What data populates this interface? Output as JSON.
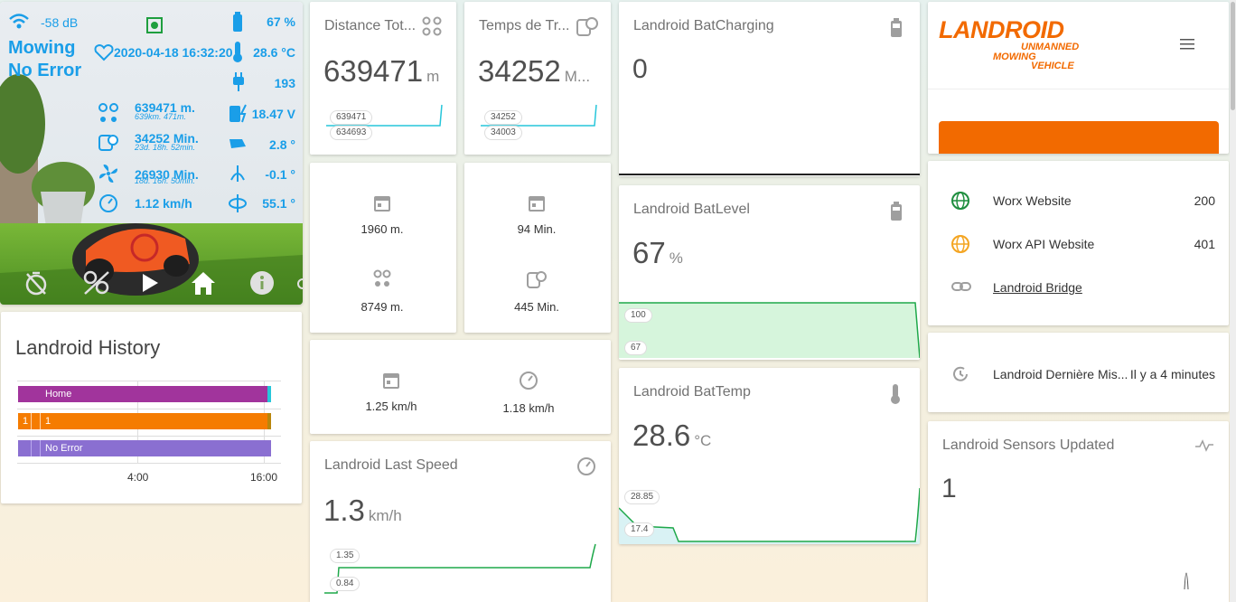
{
  "mower": {
    "wifi": "-58 dB",
    "status": "Mowing",
    "error": "No Error",
    "datetime": "2020-04-18 16:32:20",
    "battery": "67 %",
    "temperature": "28.6 °C",
    "charge_cycles": "193",
    "distance": "639471 m.",
    "distance_sub": "639km. 471m.",
    "voltage": "18.47 V",
    "work_time": "34252 Min.",
    "work_time_sub": "23d. 18h. 52min.",
    "pitch": "2.8 °",
    "blade_time": "26930 Min.",
    "blade_time_sub": "18d. 16h. 50min.",
    "roll": "-0.1 °",
    "speed": "1.12 km/h",
    "yaw": "55.1 °"
  },
  "distance_card": {
    "title": "Distance Tot...",
    "value": "639471",
    "unit": "m",
    "max": "639471",
    "min": "634693"
  },
  "time_card": {
    "title": "Temps de Tr...",
    "value": "34252",
    "unit": "M...",
    "max": "34252",
    "min": "34003"
  },
  "today_card": {
    "dist_today": "1960 m.",
    "time_today": "94 Min.",
    "dist_week": "8749 m.",
    "time_week": "445 Min."
  },
  "speed_stats": {
    "avg": "1.25 km/h",
    "current": "1.18 km/h"
  },
  "last_speed": {
    "title": "Landroid Last Speed",
    "value": "1.3",
    "unit": "km/h",
    "max": "1.35",
    "min": "0.84"
  },
  "bat_charging": {
    "title": "Landroid BatCharging",
    "value": "0"
  },
  "bat_level": {
    "title": "Landroid BatLevel",
    "value": "67",
    "unit": "%",
    "max": "100",
    "min": "67"
  },
  "bat_temp": {
    "title": "Landroid BatTemp",
    "value": "28.6",
    "unit": "°C",
    "max": "28.85",
    "min": "17.4"
  },
  "history": {
    "title": "Landroid History",
    "rows": [
      {
        "label": "Home",
        "color": "#a1349c"
      },
      {
        "label": "1",
        "prefix": "1",
        "color": "#f57c00"
      },
      {
        "label": "No Error",
        "color": "#8a6fd1"
      }
    ],
    "ticks": [
      "4:00",
      "16:00"
    ]
  },
  "brand": {
    "logo": "LANDROID",
    "tag1": "UNMANNED",
    "tag2": "MOWING",
    "tag3": "VEHICLE",
    "accent": "#f26a00"
  },
  "links": [
    {
      "label": "Worx Website",
      "value": "200",
      "icon": "globe-icon",
      "color": "#1e8e3e"
    },
    {
      "label": "Worx API Website",
      "value": "401",
      "icon": "globe-icon",
      "color": "#f4a522"
    },
    {
      "label": "Landroid Bridge",
      "value": "",
      "icon": "link-icon",
      "color": "#9e9e9e"
    }
  ],
  "last_update": {
    "label": "Landroid Dernière Mis...",
    "value": "Il y a 4 minutes"
  },
  "sensors": {
    "title": "Landroid Sensors Updated",
    "value": "1"
  }
}
